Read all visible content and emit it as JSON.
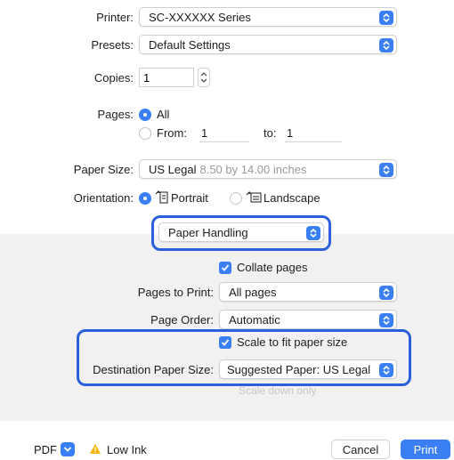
{
  "printer": {
    "label": "Printer:",
    "value": "SC-XXXXXX Series"
  },
  "presets": {
    "label": "Presets:",
    "value": "Default Settings"
  },
  "copies": {
    "label": "Copies:",
    "value": "1"
  },
  "pages": {
    "label": "Pages:",
    "all_label": "All",
    "from_label": "From:",
    "from_value": "1",
    "to_label": "to:",
    "to_value": "1"
  },
  "paper_size": {
    "label": "Paper Size:",
    "name": "US Legal",
    "detail": "8.50 by 14.00 inches"
  },
  "orientation": {
    "label": "Orientation:",
    "portrait": "Portrait",
    "landscape": "Landscape"
  },
  "section_popup": {
    "value": "Paper Handling"
  },
  "paper_handling": {
    "collate_label": "Collate pages",
    "pages_to_print_label": "Pages to Print:",
    "pages_to_print_value": "All pages",
    "page_order_label": "Page Order:",
    "page_order_value": "Automatic",
    "scale_label": "Scale to fit paper size",
    "dest_label": "Destination Paper Size:",
    "dest_value": "Suggested Paper: US Legal",
    "scale_down_label": "Scale down only"
  },
  "footer": {
    "pdf_label": "PDF",
    "low_ink_label": "Low Ink",
    "cancel_label": "Cancel",
    "print_label": "Print"
  },
  "colors": {
    "accent": "#3a7ff5",
    "highlight_ring": "#2b5fdc",
    "warning": "#f5b400"
  }
}
